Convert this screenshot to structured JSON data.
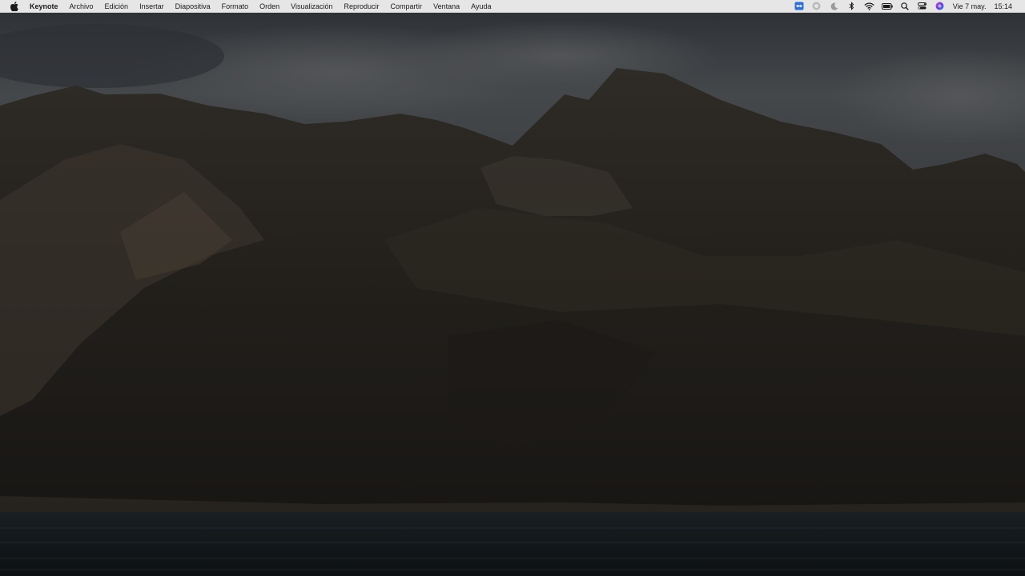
{
  "menubar": {
    "app_name": "Keynote",
    "menus": [
      "Archivo",
      "Edición",
      "Insertar",
      "Diapositiva",
      "Formato",
      "Orden",
      "Visualización",
      "Reproducir",
      "Compartir",
      "Ventana",
      "Ayuda"
    ],
    "status_icons": [
      "teamviewer-icon",
      "screen-record-icon",
      "moon-icon",
      "bluetooth-icon",
      "wifi-icon",
      "battery-icon",
      "spotlight-search-icon",
      "control-center-icon",
      "siri-icon"
    ],
    "date": "Vie 7 may.",
    "time": "15:14"
  },
  "colors": {
    "menubar_bg": "#e6e6e6",
    "sky": "#43464a",
    "mountain": "#26231f",
    "water": "#101417"
  }
}
